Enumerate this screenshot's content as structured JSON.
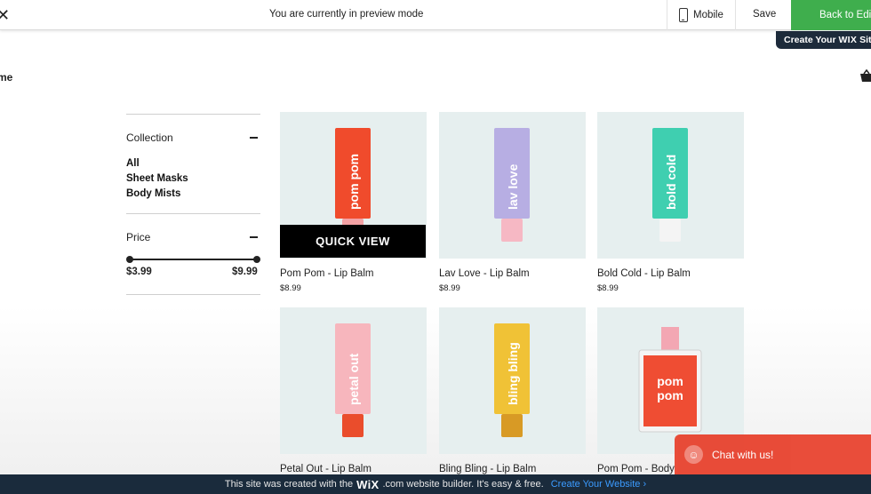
{
  "topbar": {
    "close_glyph": "✕",
    "preview_text": "You are currently in preview mode",
    "mobile_label": "Mobile",
    "save_label": "Save",
    "back_label": "Back to Editor"
  },
  "create_tab": {
    "prefix": "Create Your ",
    "brand": "WIX",
    "suffix": " Site"
  },
  "site": {
    "name_fragment": "me"
  },
  "filters": {
    "collection": {
      "title": "Collection",
      "items": [
        "All",
        "Sheet Masks",
        "Body Mists"
      ]
    },
    "price": {
      "title": "Price",
      "min": "$3.99",
      "max": "$9.99"
    }
  },
  "quick_view_label": "QUICK VIEW",
  "products": [
    {
      "name": "Pom Pom - Lip Balm",
      "price": "$8.99",
      "label": "pom pom",
      "color": "#f04b2c",
      "cap": "#f3a1a4"
    },
    {
      "name": "Lav Love - Lip Balm",
      "price": "$8.99",
      "label": "lav love",
      "color": "#b7aee3",
      "cap": "#f6b8c4"
    },
    {
      "name": "Bold Cold - Lip Balm",
      "price": "$8.99",
      "label": "bold cold",
      "color": "#3fcfb0",
      "cap": "#f4f4f4"
    },
    {
      "name": "Petal Out - Lip Balm",
      "price": "",
      "label": "petal out",
      "color": "#f7b6bd",
      "cap": "#ea4d2c"
    },
    {
      "name": "Bling Bling - Lip Balm",
      "price": "",
      "label": "bling bling",
      "color": "#f0c236",
      "cap": "#d89a25"
    },
    {
      "name": "Pom Pom - Body",
      "price": "",
      "label": "pom pom",
      "color": "#ef4d33",
      "cap": "#f3a7b3"
    }
  ],
  "chat": {
    "label": "Chat with us!"
  },
  "banner": {
    "prefix": "This site was created with the",
    "brand": "WiX",
    "suffix": ".com website builder. It's easy & free.",
    "link": "Create Your Website ›"
  }
}
